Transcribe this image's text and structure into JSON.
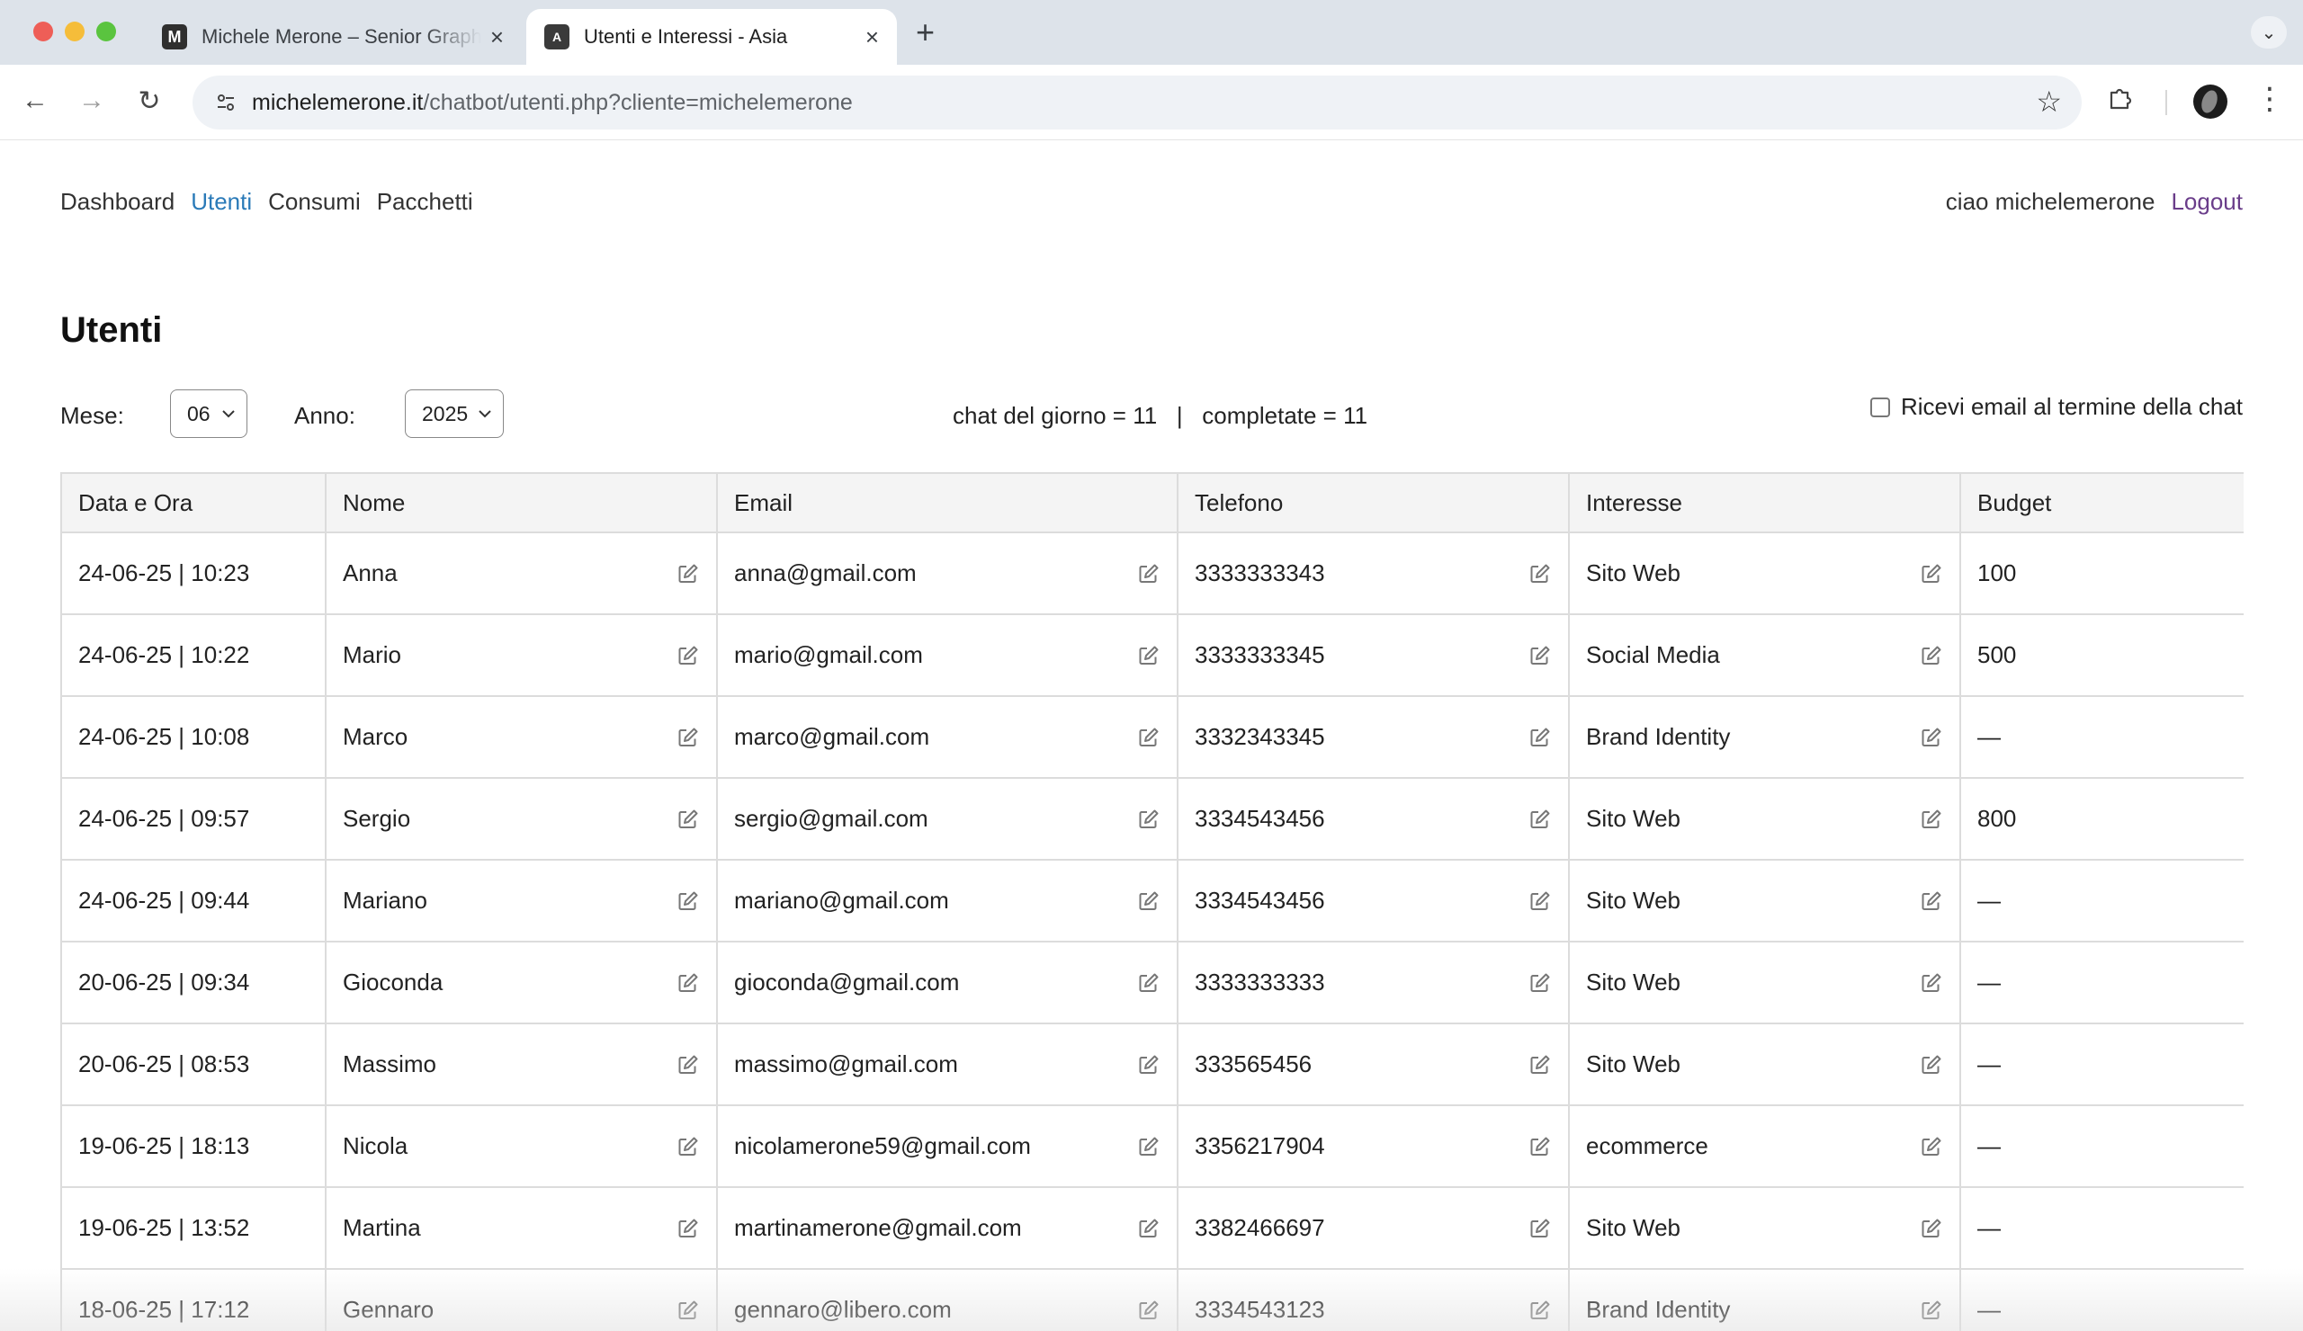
{
  "browser": {
    "tabs": [
      {
        "title": "Michele Merone – Senior Graphic Designer",
        "favicon": "M",
        "active": false
      },
      {
        "title": "Utenti e Interessi - Asia",
        "favicon": "A",
        "active": true
      }
    ],
    "new_tab_label": "+",
    "url_host": "michelemerone.it",
    "url_path": "/chatbot/utenti.php?cliente=michelemerone"
  },
  "nav": {
    "items": [
      "Dashboard",
      "Utenti",
      "Consumi",
      "Pacchetti"
    ],
    "active": "Utenti",
    "greeting": "ciao michelemerone",
    "logout": "Logout"
  },
  "page_title": "Utenti",
  "filters": {
    "month_label": "Mese:",
    "month_value": "06",
    "year_label": "Anno:",
    "year_value": "2025",
    "stats_text": "chat del giorno = 11   |   completate = 11",
    "email_option_label": "Ricevi email al termine della chat",
    "email_option_checked": false
  },
  "table": {
    "headers": [
      "Data e Ora",
      "Nome",
      "Email",
      "Telefono",
      "Interesse",
      "Budget"
    ],
    "rows": [
      [
        "24-06-25 | 10:23",
        "Anna",
        "anna@gmail.com",
        "3333333343",
        "Sito Web",
        "100"
      ],
      [
        "24-06-25 | 10:22",
        "Mario",
        "mario@gmail.com",
        "3333333345",
        "Social Media",
        "500"
      ],
      [
        "24-06-25 | 10:08",
        "Marco",
        "marco@gmail.com",
        "3332343345",
        "Brand Identity",
        "—"
      ],
      [
        "24-06-25 | 09:57",
        "Sergio",
        "sergio@gmail.com",
        "3334543456",
        "Sito Web",
        "800"
      ],
      [
        "24-06-25 | 09:44",
        "Mariano",
        "mariano@gmail.com",
        "3334543456",
        "Sito Web",
        "—"
      ],
      [
        "20-06-25 | 09:34",
        "Gioconda",
        "gioconda@gmail.com",
        "3333333333",
        "Sito Web",
        "—"
      ],
      [
        "20-06-25 | 08:53",
        "Massimo",
        "massimo@gmail.com",
        "333565456",
        "Sito Web",
        "—"
      ],
      [
        "19-06-25 | 18:13",
        "Nicola",
        "nicolamerone59@gmail.com",
        "3356217904",
        "ecommerce",
        "—"
      ],
      [
        "19-06-25 | 13:52",
        "Martina",
        "martinamerone@gmail.com",
        "3382466697",
        "Sito Web",
        "—"
      ],
      [
        "18-06-25 | 17:12",
        "Gennaro",
        "gennaro@libero.com",
        "3334543123",
        "Brand Identity",
        "—"
      ]
    ],
    "editable_columns": [
      1,
      2,
      3,
      4
    ]
  },
  "colors": {
    "active_nav": "#2a7ab8",
    "logout": "#6a3d8a",
    "header_bg": "#f4f4f4",
    "border": "#dcdcdc"
  },
  "icons": {
    "edit": "edit-pencil-icon",
    "checkbox": "checkbox-icon"
  }
}
